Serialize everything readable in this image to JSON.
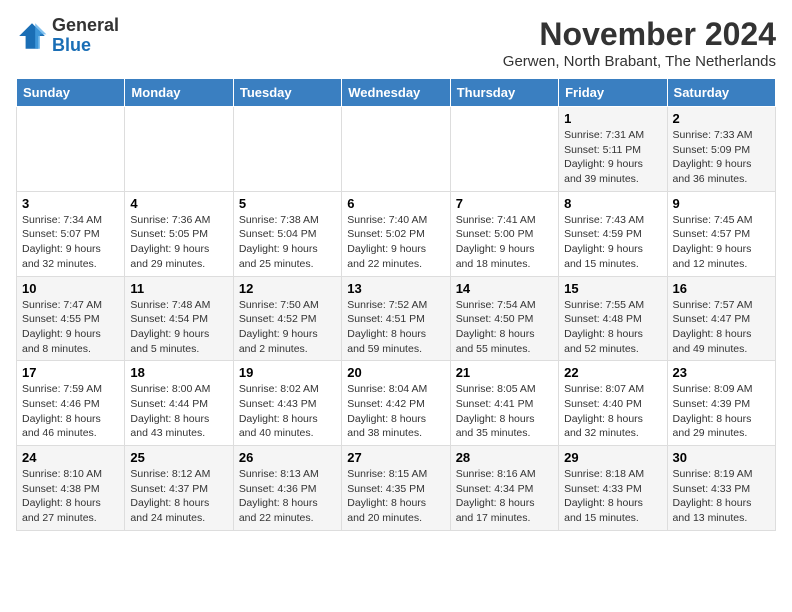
{
  "header": {
    "logo_general": "General",
    "logo_blue": "Blue",
    "month_year": "November 2024",
    "location": "Gerwen, North Brabant, The Netherlands"
  },
  "weekdays": [
    "Sunday",
    "Monday",
    "Tuesday",
    "Wednesday",
    "Thursday",
    "Friday",
    "Saturday"
  ],
  "weeks": [
    [
      {
        "day": "",
        "info": ""
      },
      {
        "day": "",
        "info": ""
      },
      {
        "day": "",
        "info": ""
      },
      {
        "day": "",
        "info": ""
      },
      {
        "day": "",
        "info": ""
      },
      {
        "day": "1",
        "info": "Sunrise: 7:31 AM\nSunset: 5:11 PM\nDaylight: 9 hours and 39 minutes."
      },
      {
        "day": "2",
        "info": "Sunrise: 7:33 AM\nSunset: 5:09 PM\nDaylight: 9 hours and 36 minutes."
      }
    ],
    [
      {
        "day": "3",
        "info": "Sunrise: 7:34 AM\nSunset: 5:07 PM\nDaylight: 9 hours and 32 minutes."
      },
      {
        "day": "4",
        "info": "Sunrise: 7:36 AM\nSunset: 5:05 PM\nDaylight: 9 hours and 29 minutes."
      },
      {
        "day": "5",
        "info": "Sunrise: 7:38 AM\nSunset: 5:04 PM\nDaylight: 9 hours and 25 minutes."
      },
      {
        "day": "6",
        "info": "Sunrise: 7:40 AM\nSunset: 5:02 PM\nDaylight: 9 hours and 22 minutes."
      },
      {
        "day": "7",
        "info": "Sunrise: 7:41 AM\nSunset: 5:00 PM\nDaylight: 9 hours and 18 minutes."
      },
      {
        "day": "8",
        "info": "Sunrise: 7:43 AM\nSunset: 4:59 PM\nDaylight: 9 hours and 15 minutes."
      },
      {
        "day": "9",
        "info": "Sunrise: 7:45 AM\nSunset: 4:57 PM\nDaylight: 9 hours and 12 minutes."
      }
    ],
    [
      {
        "day": "10",
        "info": "Sunrise: 7:47 AM\nSunset: 4:55 PM\nDaylight: 9 hours and 8 minutes."
      },
      {
        "day": "11",
        "info": "Sunrise: 7:48 AM\nSunset: 4:54 PM\nDaylight: 9 hours and 5 minutes."
      },
      {
        "day": "12",
        "info": "Sunrise: 7:50 AM\nSunset: 4:52 PM\nDaylight: 9 hours and 2 minutes."
      },
      {
        "day": "13",
        "info": "Sunrise: 7:52 AM\nSunset: 4:51 PM\nDaylight: 8 hours and 59 minutes."
      },
      {
        "day": "14",
        "info": "Sunrise: 7:54 AM\nSunset: 4:50 PM\nDaylight: 8 hours and 55 minutes."
      },
      {
        "day": "15",
        "info": "Sunrise: 7:55 AM\nSunset: 4:48 PM\nDaylight: 8 hours and 52 minutes."
      },
      {
        "day": "16",
        "info": "Sunrise: 7:57 AM\nSunset: 4:47 PM\nDaylight: 8 hours and 49 minutes."
      }
    ],
    [
      {
        "day": "17",
        "info": "Sunrise: 7:59 AM\nSunset: 4:46 PM\nDaylight: 8 hours and 46 minutes."
      },
      {
        "day": "18",
        "info": "Sunrise: 8:00 AM\nSunset: 4:44 PM\nDaylight: 8 hours and 43 minutes."
      },
      {
        "day": "19",
        "info": "Sunrise: 8:02 AM\nSunset: 4:43 PM\nDaylight: 8 hours and 40 minutes."
      },
      {
        "day": "20",
        "info": "Sunrise: 8:04 AM\nSunset: 4:42 PM\nDaylight: 8 hours and 38 minutes."
      },
      {
        "day": "21",
        "info": "Sunrise: 8:05 AM\nSunset: 4:41 PM\nDaylight: 8 hours and 35 minutes."
      },
      {
        "day": "22",
        "info": "Sunrise: 8:07 AM\nSunset: 4:40 PM\nDaylight: 8 hours and 32 minutes."
      },
      {
        "day": "23",
        "info": "Sunrise: 8:09 AM\nSunset: 4:39 PM\nDaylight: 8 hours and 29 minutes."
      }
    ],
    [
      {
        "day": "24",
        "info": "Sunrise: 8:10 AM\nSunset: 4:38 PM\nDaylight: 8 hours and 27 minutes."
      },
      {
        "day": "25",
        "info": "Sunrise: 8:12 AM\nSunset: 4:37 PM\nDaylight: 8 hours and 24 minutes."
      },
      {
        "day": "26",
        "info": "Sunrise: 8:13 AM\nSunset: 4:36 PM\nDaylight: 8 hours and 22 minutes."
      },
      {
        "day": "27",
        "info": "Sunrise: 8:15 AM\nSunset: 4:35 PM\nDaylight: 8 hours and 20 minutes."
      },
      {
        "day": "28",
        "info": "Sunrise: 8:16 AM\nSunset: 4:34 PM\nDaylight: 8 hours and 17 minutes."
      },
      {
        "day": "29",
        "info": "Sunrise: 8:18 AM\nSunset: 4:33 PM\nDaylight: 8 hours and 15 minutes."
      },
      {
        "day": "30",
        "info": "Sunrise: 8:19 AM\nSunset: 4:33 PM\nDaylight: 8 hours and 13 minutes."
      }
    ]
  ]
}
